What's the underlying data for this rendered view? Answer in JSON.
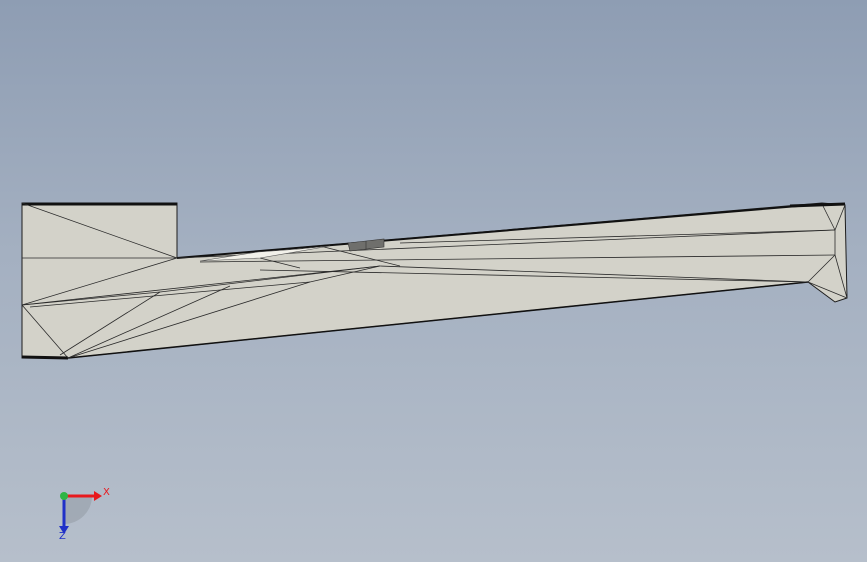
{
  "viewport": {
    "background_top": "#8e9db3",
    "background_bottom": "#b6bfcb"
  },
  "model": {
    "face_color": "#d3d2c9",
    "edge_color": "#1c1c1c",
    "highlight_color": "#f2f1ea",
    "shadow_color": "#6f6f6c"
  },
  "triad": {
    "x_label": "X",
    "z_label": "Z",
    "x_color": "#e8191d",
    "y_color": "#2fb544",
    "z_color": "#2030c8"
  }
}
